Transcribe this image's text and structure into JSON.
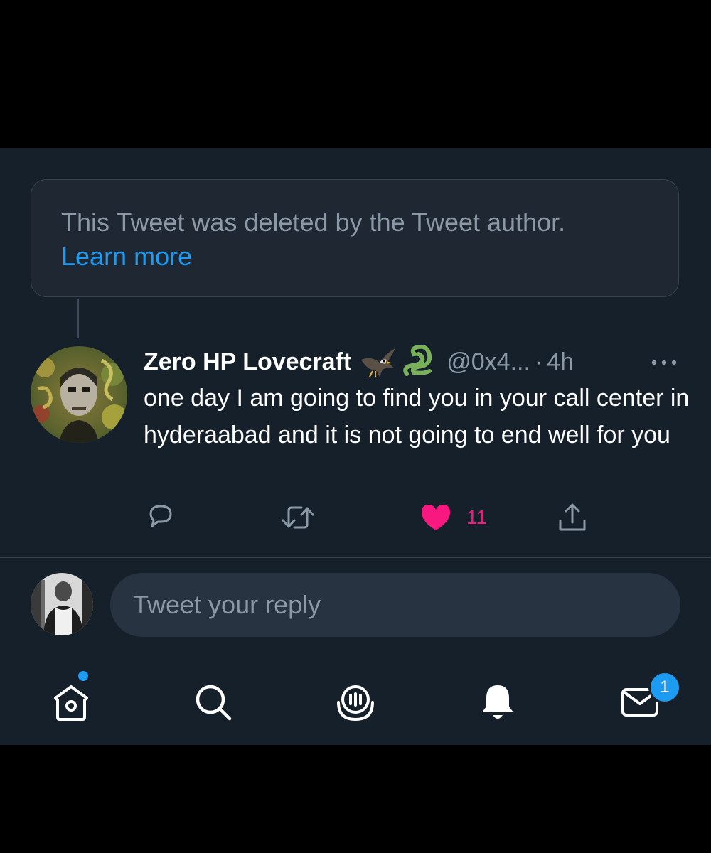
{
  "deleted_notice": {
    "text": "This Tweet was deleted by the Tweet author.",
    "link": "Learn more"
  },
  "tweet": {
    "display_name": "Zero HP Lovecraft",
    "badge_icons": [
      "eagle-emoji-icon",
      "snake-emoji-icon"
    ],
    "handle": "@0x4...",
    "separator": "·",
    "time": "4h",
    "text": "one day I am going to find you in your call center in hyderaabad and it is not going to end well for you",
    "actions": {
      "reply_count": "",
      "retweet_count": "",
      "like_count": "11",
      "liked": true
    }
  },
  "reply_box": {
    "placeholder": "Tweet your reply"
  },
  "bottom_nav": {
    "items": [
      "home-icon",
      "search-icon",
      "spaces-icon",
      "notifications-icon",
      "messages-icon"
    ],
    "messages_badge": "1",
    "home_has_new": true
  },
  "colors": {
    "background": "#15202b",
    "accent": "#1d9bf0",
    "like": "#f91880",
    "secondary_text": "#8b98a5",
    "border": "#38444d"
  }
}
